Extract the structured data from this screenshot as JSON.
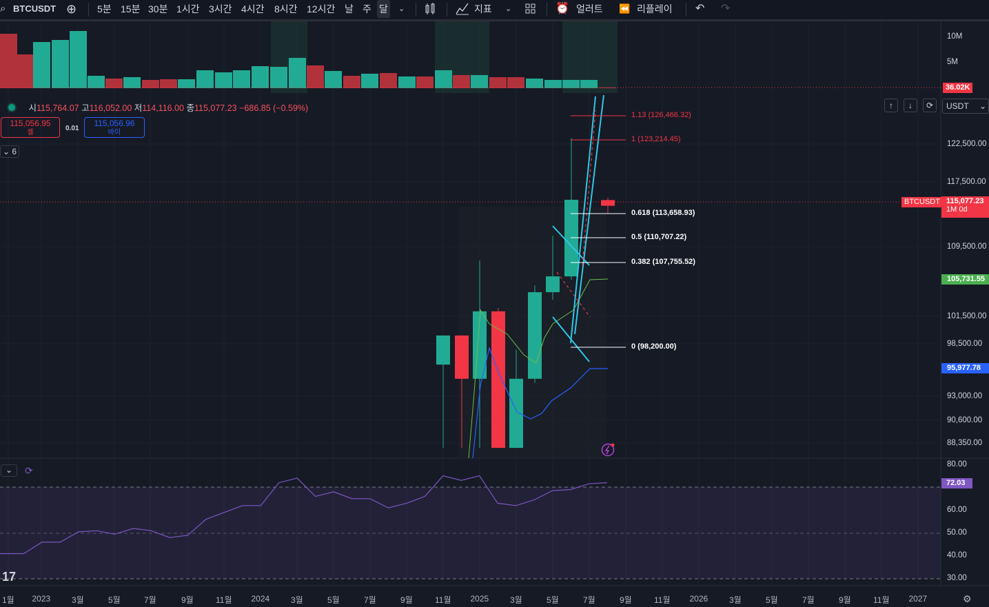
{
  "toolbar": {
    "symbol": "BTCUSDT",
    "intervals": [
      "5분",
      "15분",
      "30분",
      "1시간",
      "3시간",
      "4시간",
      "8시간",
      "12시간",
      "날",
      "주",
      "달"
    ],
    "active_interval": "달",
    "indicators_label": "지표",
    "alert_label": "얼러트",
    "replay_label": "리플레이"
  },
  "legend": {
    "open_k": "시",
    "open_v": "115,764.07",
    "high_k": "고",
    "high_v": "116,052.00",
    "low_k": "저",
    "low_v": "114,116.00",
    "close_k": "종",
    "close_v": "115,077.23",
    "change": "−686.85 (−0.59%)"
  },
  "trade": {
    "sell_price": "115,056.95",
    "sell_label": "셀",
    "spread": "0.01",
    "buy_price": "115,056.96",
    "buy_label": "바이"
  },
  "indicator_count": "6",
  "currency": "USDT",
  "price_axis": [
    "122,500.00",
    "117,500.00",
    "109,500.00",
    "101,500.00",
    "98,500.00",
    "93,000.00",
    "90,600.00",
    "88,350.00"
  ],
  "volume_axis": [
    "10M",
    "5M"
  ],
  "volume_tag": "36.02K",
  "price_tags": {
    "symbol": "BTCUSDT",
    "last": "115,077.23",
    "countdown": "1M 0d",
    "green": "105,731.55",
    "blue": "95,977.78"
  },
  "fib_levels": [
    {
      "label": "1.13 (126,466.32)",
      "color": "#f23645"
    },
    {
      "label": "1 (123,214.45)",
      "color": "#f23645"
    },
    {
      "label": "0.618 (113,658.93)",
      "color": "#ffffff"
    },
    {
      "label": "0.5 (110,707.22)",
      "color": "#ffffff"
    },
    {
      "label": "0.382 (107,755.52)",
      "color": "#ffffff"
    },
    {
      "label": "0 (98,200.00)",
      "color": "#ffffff"
    }
  ],
  "rsi_axis": [
    "80.00",
    "60.00",
    "50.00",
    "40.00",
    "30.00"
  ],
  "rsi_value": "72.03",
  "time_axis": [
    "1월",
    "2023",
    "3월",
    "5월",
    "7월",
    "9월",
    "11월",
    "2024",
    "3월",
    "5월",
    "7월",
    "9월",
    "11월",
    "2025",
    "3월",
    "5월",
    "7월",
    "9월",
    "11월",
    "2026",
    "3월",
    "5월",
    "7월",
    "9월",
    "11월",
    "2027"
  ],
  "chart_data": {
    "type": "candlestick",
    "candles": [
      {
        "o": 96000,
        "h": 99500,
        "l": 86000,
        "c": 99500,
        "dir": "up"
      },
      {
        "o": 99500,
        "h": 99500,
        "l": 86000,
        "c": 94300,
        "dir": "down"
      },
      {
        "o": 94300,
        "h": 108500,
        "l": 86000,
        "c": 102400,
        "dir": "up"
      },
      {
        "o": 102400,
        "h": 102800,
        "l": 86000,
        "c": 86000,
        "dir": "down"
      },
      {
        "o": 86000,
        "h": 97800,
        "l": 86000,
        "c": 94300,
        "dir": "up"
      },
      {
        "o": 94300,
        "h": 105500,
        "l": 93800,
        "c": 104700,
        "dir": "up"
      },
      {
        "o": 104700,
        "h": 111500,
        "l": 103800,
        "c": 106600,
        "dir": "up"
      },
      {
        "o": 106600,
        "h": 123200,
        "l": 106200,
        "c": 115800,
        "dir": "up"
      },
      {
        "o": 115764.07,
        "h": 116052,
        "l": 114116,
        "c": 115077.23,
        "dir": "down"
      }
    ],
    "volume_axis_max": "10M",
    "rsi": [
      41,
      41,
      46,
      46,
      50.5,
      51,
      49.5,
      52,
      51,
      48,
      49,
      56,
      59,
      62,
      62,
      72,
      74,
      66,
      68,
      65,
      65,
      61,
      63,
      66,
      75,
      73,
      75,
      63,
      62,
      64.5,
      68.5,
      69,
      71.5,
      72.03
    ],
    "rsi_range": [
      30,
      80
    ]
  }
}
